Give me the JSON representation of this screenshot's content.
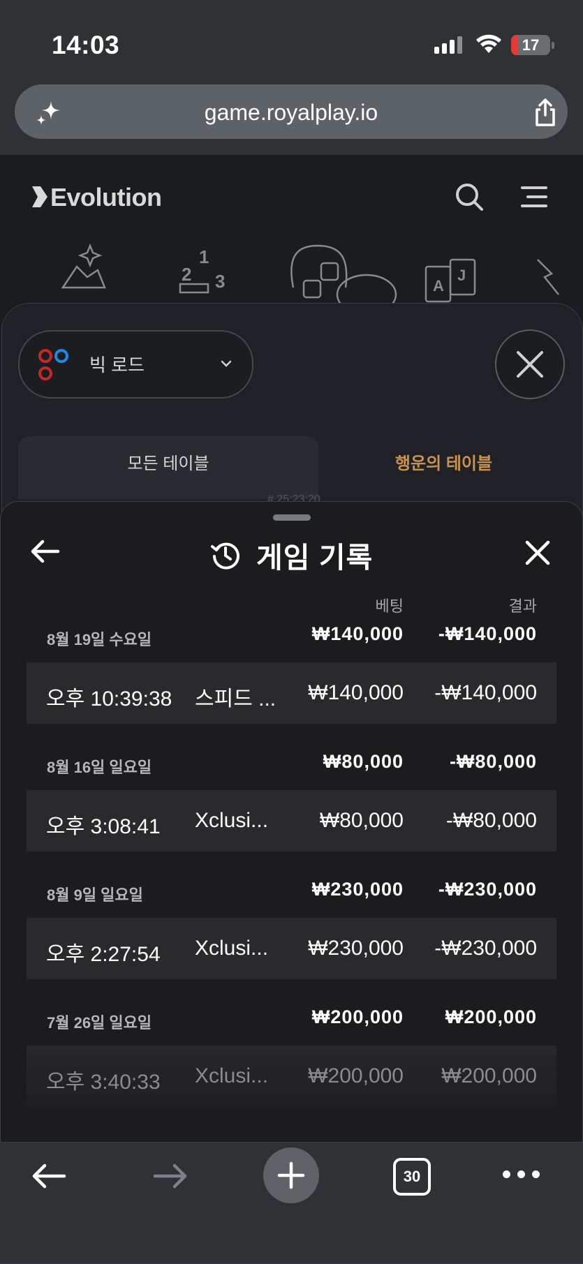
{
  "status_bar": {
    "time": "14:03",
    "battery": "17"
  },
  "browser": {
    "url": "game.royalplay.io",
    "tab_count": "30"
  },
  "background_page": {
    "brand": "Evolution"
  },
  "road_panel": {
    "road_select_label": "빅 로드",
    "tabs": [
      {
        "label": "모든 테이블"
      },
      {
        "label": "행운의 테이블"
      }
    ],
    "partial_timestamp": "# 25:23:20"
  },
  "history": {
    "title": "게임 기록",
    "col_bet": "베팅",
    "col_result": "결과",
    "groups": [
      {
        "date": "8월 19일 수요일",
        "bet": "₩140,000",
        "result": "-₩140,000",
        "rows": [
          {
            "time": "오후 10:39:38",
            "game": "스피드 ...",
            "bet": "₩140,000",
            "result": "-₩140,000"
          }
        ]
      },
      {
        "date": "8월 16일 일요일",
        "bet": "₩80,000",
        "result": "-₩80,000",
        "rows": [
          {
            "time": "오후 3:08:41",
            "game": "Xclusi...",
            "bet": "₩80,000",
            "result": "-₩80,000"
          }
        ]
      },
      {
        "date": "8월 9일 일요일",
        "bet": "₩230,000",
        "result": "-₩230,000",
        "rows": [
          {
            "time": "오후 2:27:54",
            "game": "Xclusi...",
            "bet": "₩230,000",
            "result": "-₩230,000"
          }
        ]
      },
      {
        "date": "7월 26일 일요일",
        "bet": "₩200,000",
        "result": "₩200,000",
        "rows": [
          {
            "time": "오후 3:40:33",
            "game": "Xclusi...",
            "bet": "₩200,000",
            "result": "₩200,000"
          }
        ]
      }
    ]
  },
  "colors": {
    "accent_gold": "#c8944d",
    "sheet_bg": "#1c1c1e",
    "row_bg": "#2a2a2d"
  }
}
